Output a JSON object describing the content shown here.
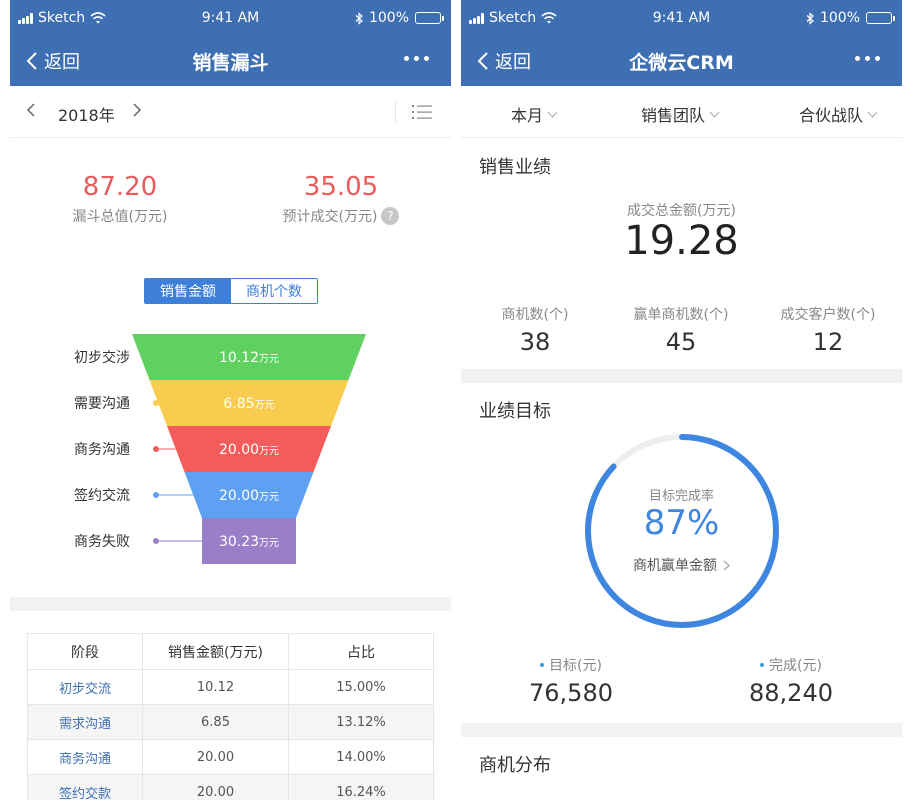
{
  "status_bar": {
    "carrier": "Sketch",
    "time": "9:41 AM",
    "battery": "100%"
  },
  "left": {
    "nav": {
      "back_label": "返回",
      "title": "销售漏斗"
    },
    "year_selector": {
      "year": "2018年"
    },
    "stats": [
      {
        "value": "87.20",
        "label": "漏斗总值(万元)"
      },
      {
        "value": "35.05",
        "label": "预计成交(万元)",
        "help": "?"
      }
    ],
    "toggle": {
      "options": [
        "销售金额",
        "商机个数"
      ],
      "selected": 0
    },
    "funnel": {
      "unit": "万元",
      "stages": [
        {
          "label": "初步交涉",
          "value": "10.12",
          "color": "#5fd160"
        },
        {
          "label": "需要沟通",
          "value": "6.85",
          "color": "#f8cd4f"
        },
        {
          "label": "商务沟通",
          "value": "20.00",
          "color": "#f45c5c"
        },
        {
          "label": "签约交流",
          "value": "20.00",
          "color": "#5ea0f2"
        },
        {
          "label": "商务失败",
          "value": "30.23",
          "color": "#9b7ec8"
        }
      ]
    },
    "table": {
      "headers": [
        "阶段",
        "销售金额(万元)",
        "占比"
      ],
      "rows": [
        {
          "stage": "初步交流",
          "amount": "10.12",
          "ratio": "15.00%"
        },
        {
          "stage": "需求沟通",
          "amount": "6.85",
          "ratio": "13.12%"
        },
        {
          "stage": "商务沟通",
          "amount": "20.00",
          "ratio": "14.00%"
        },
        {
          "stage": "签约交款",
          "amount": "20.00",
          "ratio": "16.24%"
        }
      ]
    }
  },
  "right": {
    "nav": {
      "back_label": "返回",
      "title": "企微云CRM"
    },
    "filters": [
      {
        "label": "本月"
      },
      {
        "label": "销售团队"
      },
      {
        "label": "合伙战队"
      }
    ],
    "sales": {
      "title": "销售业绩",
      "total_label": "成交总金额(万元)",
      "total_value": "19.28",
      "metrics": [
        {
          "label": "商机数(个)",
          "value": "38"
        },
        {
          "label": "赢单商机数(个)",
          "value": "45"
        },
        {
          "label": "成交客户数(个)",
          "value": "12"
        }
      ]
    },
    "target": {
      "title": "业绩目标",
      "ring_label": "目标完成率",
      "percent": 87,
      "percent_text": "87%",
      "link_label": "商机赢单金额",
      "ring_color": "#3e86e0",
      "goals": [
        {
          "label": "目标(元)",
          "value": "76,580"
        },
        {
          "label": "完成(元)",
          "value": "88,240"
        }
      ]
    },
    "distribution": {
      "title": "商机分布"
    }
  }
}
